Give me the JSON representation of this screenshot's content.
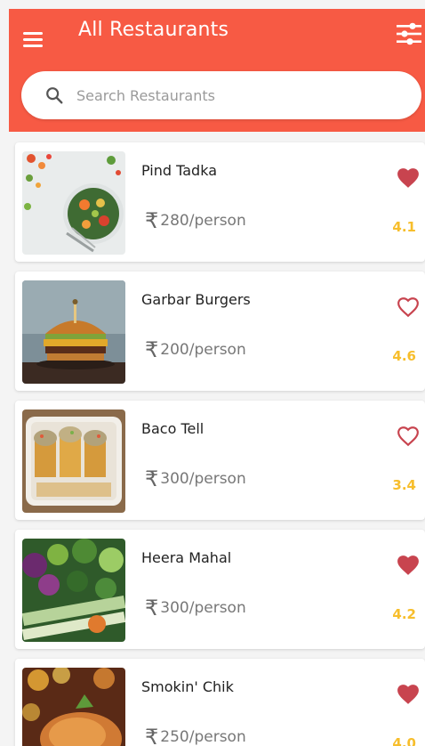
{
  "header": {
    "title": "All Restaurants",
    "menu_icon": "hamburger-menu-icon",
    "filter_icon": "filter-sliders-icon",
    "background_color": "#f75a44"
  },
  "search": {
    "placeholder": "Search Restaurants",
    "value": "",
    "icon": "search-icon"
  },
  "restaurants": [
    {
      "name": "Pind Tadka",
      "price": "280/person",
      "rating": "4.1",
      "favorite": true,
      "image": "salad-bowl"
    },
    {
      "name": "Garbar Burgers",
      "price": "200/person",
      "rating": "4.6",
      "favorite": false,
      "image": "burger"
    },
    {
      "name": "Baco Tell",
      "price": "300/person",
      "rating": "3.4",
      "favorite": false,
      "image": "tacos-tray"
    },
    {
      "name": "Heera Mahal",
      "price": "300/person",
      "rating": "4.2",
      "favorite": true,
      "image": "vegetables"
    },
    {
      "name": "Smokin' Chik",
      "price": "250/person",
      "rating": "4.0",
      "favorite": true,
      "image": "roast-chicken"
    }
  ],
  "currency_symbol": "₹",
  "colors": {
    "accent": "#f75a44",
    "heart": "#c8444f",
    "rating": "#f7be2c"
  }
}
